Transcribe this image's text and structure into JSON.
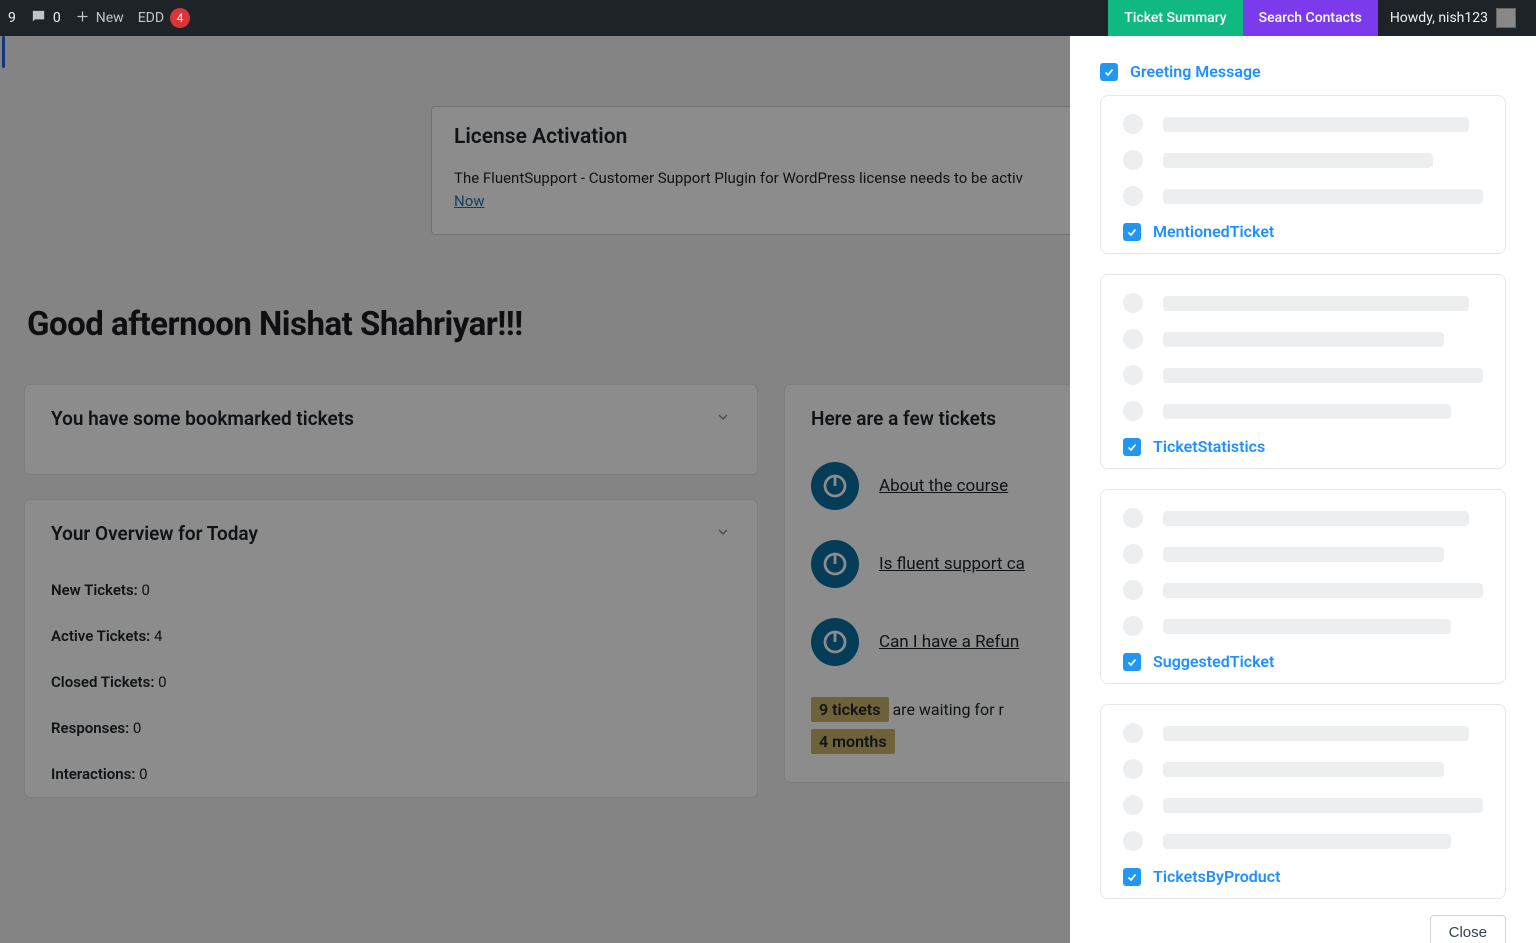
{
  "adminbar": {
    "count_a": "9",
    "comments": "0",
    "new_label": "New",
    "edd_label": "EDD",
    "edd_badge": "4",
    "ticket_summary": "Ticket Summary",
    "search_contacts": "Search Contacts",
    "howdy": "Howdy, nish123"
  },
  "notice": {
    "title": "License Activation",
    "body_prefix": "The FluentSupport - Customer Support Plugin for WordPress license needs to be activ",
    "link": "Now"
  },
  "greeting": "Good afternoon Nishat Shahriyar!!!",
  "cards": {
    "bookmarked_title": "You have some bookmarked tickets",
    "overview_title": "Your Overview for Today",
    "suggestions_title": "Here are a few tickets"
  },
  "stats": {
    "new_label": "New Tickets:",
    "new_val": " 0",
    "active_label": "Active Tickets:",
    "active_val": " 4",
    "closed_label": "Closed Tickets:",
    "closed_val": " 0",
    "responses_label": "Responses:",
    "responses_val": " 0",
    "interactions_label": "Interactions:",
    "interactions_val": " 0"
  },
  "tickets": [
    {
      "title": "About the course"
    },
    {
      "title": "Is fluent support ca"
    },
    {
      "title": "Can I have a Refun"
    }
  ],
  "waiting": {
    "count": "9 tickets",
    "mid": "  are waiting for r",
    "duration": "4 months"
  },
  "panel": {
    "widgets": [
      {
        "label": "Greeting Message",
        "checked": true,
        "top": true
      },
      {
        "label": "MentionedTicket",
        "checked": true,
        "top": false
      },
      {
        "label": "TicketStatistics",
        "checked": true,
        "top": false
      },
      {
        "label": "SuggestedTicket",
        "checked": true,
        "top": false
      },
      {
        "label": "TicketsByProduct",
        "checked": true,
        "top": false
      }
    ],
    "close": "Close"
  }
}
